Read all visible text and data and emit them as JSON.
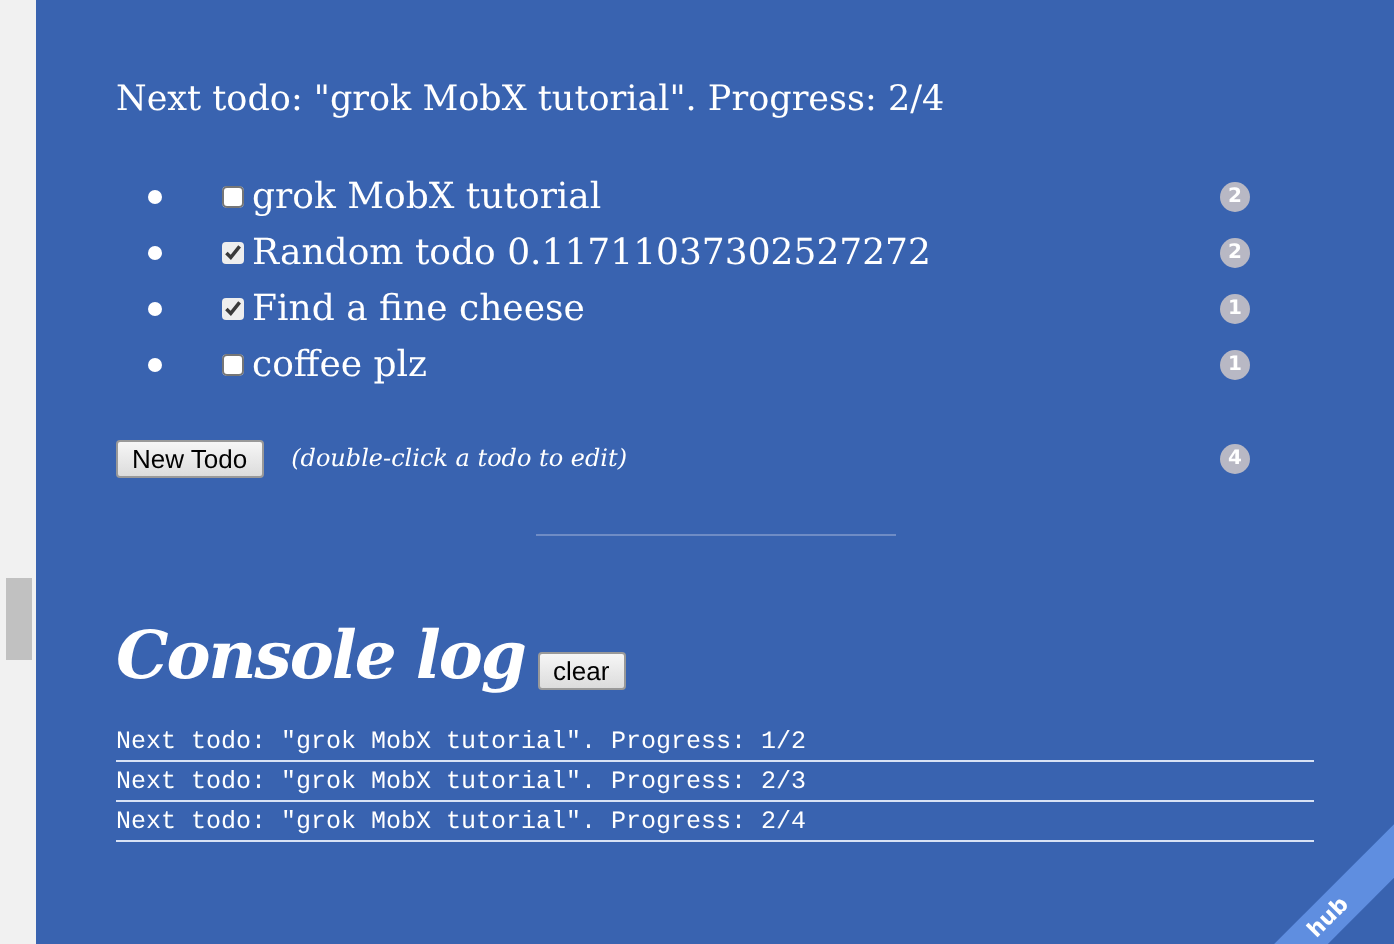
{
  "summary": "Next todo: \"grok MobX tutorial\". Progress: 2/4",
  "todos": [
    {
      "task": "grok MobX tutorial",
      "checked": false,
      "badge": "2"
    },
    {
      "task": "Random todo 0.11711037302527272",
      "checked": true,
      "badge": "2"
    },
    {
      "task": "Find a fine cheese",
      "checked": true,
      "badge": "1"
    },
    {
      "task": "coffee plz",
      "checked": false,
      "badge": "1"
    }
  ],
  "new_todo": {
    "button": "New Todo",
    "hint": "(double-click a todo to edit)",
    "badge": "4"
  },
  "console": {
    "title": "Console log",
    "clear_button": "clear",
    "lines": [
      "Next todo: \"grok MobX tutorial\". Progress: 1/2",
      "Next todo: \"grok MobX tutorial\". Progress: 2/3",
      "Next todo: \"grok MobX tutorial\". Progress: 2/4"
    ]
  },
  "ribbon": {
    "text": "hub"
  }
}
